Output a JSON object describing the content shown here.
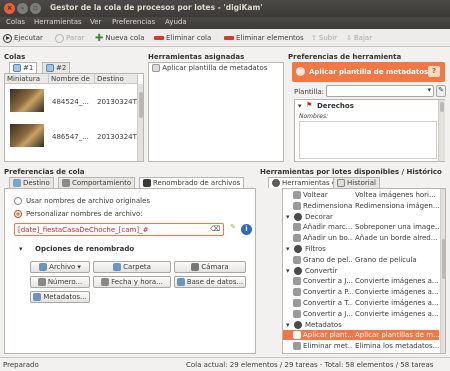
{
  "window": {
    "title": "Gestor de la cola de procesos por lotes - 'digiKam'"
  },
  "menu": [
    "Colas",
    "Herramientas",
    "Ver",
    "Preferencias",
    "Ayuda"
  ],
  "toolbar": {
    "run": "Ejecutar",
    "stop": "Parar",
    "new_queue": "Nueva cola",
    "remove_queue": "Eliminar cola",
    "remove_items": "Eliminar elementos",
    "up": "Subir",
    "down": "Bajar"
  },
  "queues": {
    "title": "Colas",
    "tabs": [
      "#1",
      "#2"
    ],
    "columns": [
      "Miniatura",
      "Nombre de",
      "Destino"
    ],
    "rows": [
      {
        "name": "484524_...",
        "dest": "20130324T..."
      },
      {
        "name": "486547_...",
        "dest": "20130324T..."
      }
    ]
  },
  "assigned": {
    "title": "Herramientas asignadas",
    "items": [
      "Aplicar plantilla de metadatos"
    ]
  },
  "tool_settings": {
    "title": "Preferencias de herramienta",
    "tool_name": "Aplicar plantilla de metadatos",
    "template_label": "Plantilla:",
    "section": "Derechos",
    "field": "Nombres:"
  },
  "queue_settings": {
    "title": "Preferencias de cola",
    "tabs": [
      "Destino",
      "Comportamiento",
      "Renombrado de archivos"
    ],
    "opt_original": "Usar nombres de archivo originales",
    "opt_custom": "Personalizar nombres de archivo:",
    "pattern": "[date]_fiestaCasaDeChoche_[cam]_#",
    "rename_options": "Opciones de renombrado",
    "buttons": [
      "Archivo",
      "Carpeta",
      "Cámara",
      "Número...",
      "Fecha y hora...",
      "Base de datos...",
      "Metadatos..."
    ]
  },
  "available": {
    "title": "Herramientas por lotes disponibles / Histórico",
    "tabs": [
      "Herramientas de base",
      "Historial"
    ],
    "rows": [
      {
        "kind": "item",
        "name": "Voltear",
        "desc": "Voltea imágenes hori..."
      },
      {
        "kind": "item",
        "name": "Redimensionar",
        "desc": "Redimensiona imágen..."
      },
      {
        "kind": "group",
        "name": "Decorar"
      },
      {
        "kind": "item",
        "name": "Añadir marc...",
        "desc": "Sobreponer una image..."
      },
      {
        "kind": "item",
        "name": "Añadir un bo...",
        "desc": "Añade un borde alred..."
      },
      {
        "kind": "group",
        "name": "Filtros"
      },
      {
        "kind": "item",
        "name": "Grano de pel...",
        "desc": "Grano de película"
      },
      {
        "kind": "group",
        "name": "Convertir"
      },
      {
        "kind": "item",
        "name": "Convertir a J...",
        "desc": "Convierte imágenes a..."
      },
      {
        "kind": "item",
        "name": "Convertir a P...",
        "desc": "Convierte imágenes a..."
      },
      {
        "kind": "item",
        "name": "Convertir a T...",
        "desc": "Convierte imágenes a..."
      },
      {
        "kind": "item",
        "name": "Convertir a J...",
        "desc": "Convierte imágenes a..."
      },
      {
        "kind": "group",
        "name": "Metadatos"
      },
      {
        "kind": "sel",
        "name": "Aplicar plant...",
        "desc": "Aplicar plantillas de m..."
      },
      {
        "kind": "item",
        "name": "Eliminar met...",
        "desc": "Elimina los metadatos..."
      }
    ]
  },
  "status": {
    "left": "Preparado",
    "right": "Cola actual: 29 elementos / 29 tareas - Total: 58 elementos / 58 tareas"
  },
  "colors": {
    "accent": "#f07746",
    "titlebar": "#3c3b37"
  }
}
